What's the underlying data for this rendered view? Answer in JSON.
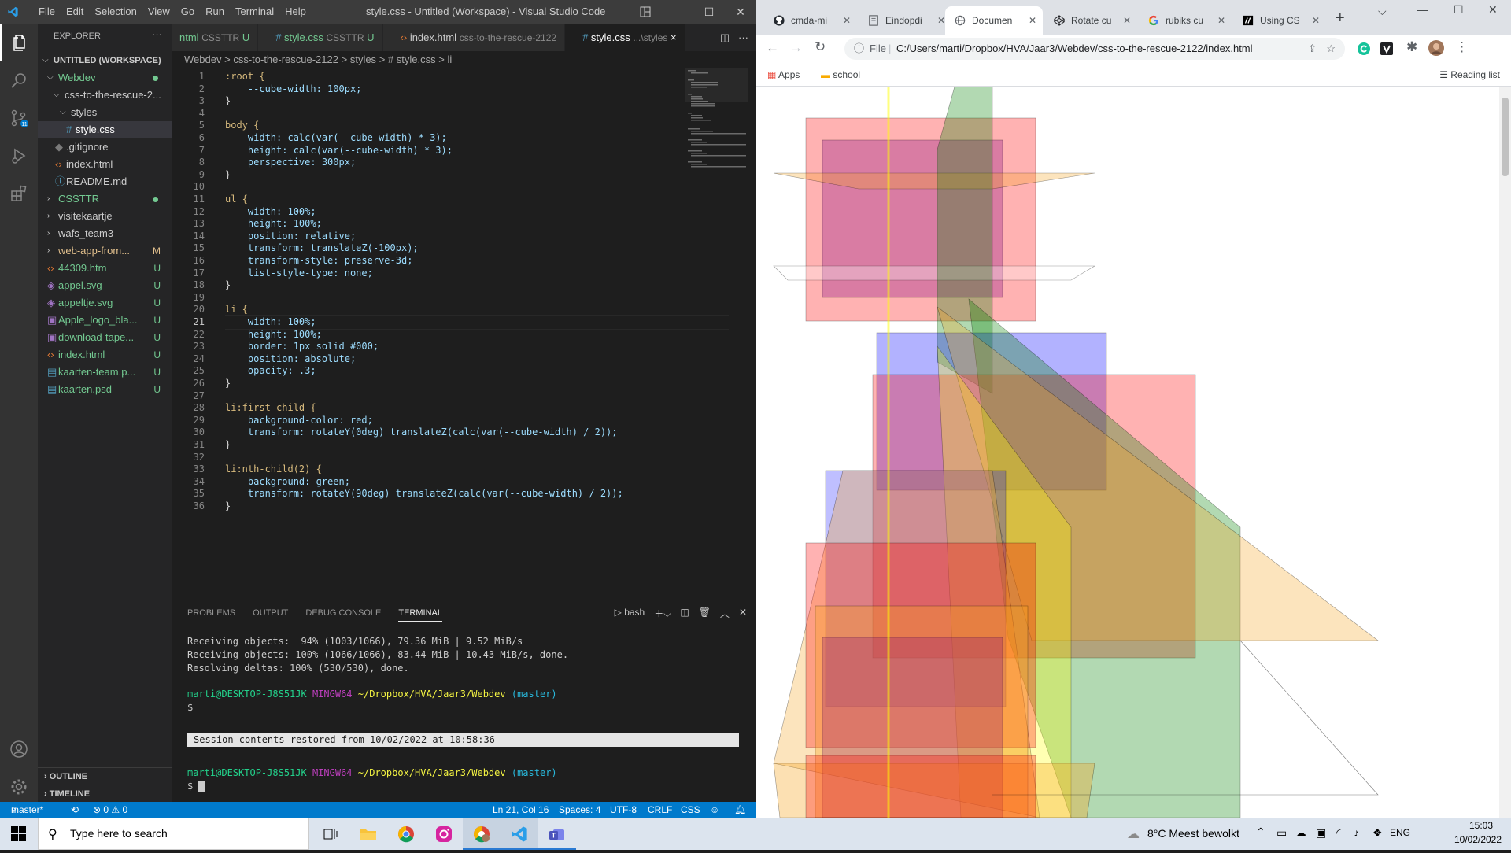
{
  "vscode": {
    "menu": [
      "File",
      "Edit",
      "Selection",
      "View",
      "Go",
      "Run",
      "Terminal",
      "Help"
    ],
    "window_title": "style.css - Untitled (Workspace) - Visual Studio Code",
    "explorer": {
      "header": "EXPLORER",
      "more": "···",
      "workspace": "UNTITLED (WORKSPACE)",
      "items": [
        {
          "label": "Webdev",
          "status": ""
        },
        {
          "label": "css-to-the-rescue-2...",
          "status": ""
        },
        {
          "label": "styles",
          "status": ""
        },
        {
          "label": "style.css",
          "status": ""
        },
        {
          "label": ".gitignore",
          "status": ""
        },
        {
          "label": "index.html",
          "status": ""
        },
        {
          "label": "README.md",
          "status": ""
        },
        {
          "label": "CSSTTR",
          "status": ""
        },
        {
          "label": "visitekaartje",
          "status": ""
        },
        {
          "label": "wafs_team3",
          "status": ""
        },
        {
          "label": "web-app-from...",
          "status": "M"
        },
        {
          "label": "44309.htm",
          "status": "U"
        },
        {
          "label": "appel.svg",
          "status": "U"
        },
        {
          "label": "appeltje.svg",
          "status": "U"
        },
        {
          "label": "Apple_logo_bla...",
          "status": "U"
        },
        {
          "label": "download-tape...",
          "status": "U"
        },
        {
          "label": "index.html",
          "status": "U"
        },
        {
          "label": "kaarten-team.p...",
          "status": "U"
        },
        {
          "label": "kaarten.psd",
          "status": "U"
        }
      ],
      "outline": "OUTLINE",
      "timeline": "TIMELINE"
    },
    "tabs": [
      {
        "name": "ntml",
        "desc": "CSSTTR",
        "badge": "U"
      },
      {
        "name": "style.css",
        "desc": "CSSTTR",
        "badge": "U"
      },
      {
        "name": "index.html",
        "desc": "css-to-the-rescue-2122",
        "badge": ""
      },
      {
        "name": "style.css",
        "desc": "...\\styles",
        "badge": "×"
      }
    ],
    "breadcrumb": [
      "Webdev",
      ">",
      "css-to-the-rescue-2122",
      ">",
      "styles",
      ">",
      "# style.css",
      ">",
      "li"
    ],
    "code": {
      "line_numbers": [
        "1",
        "2",
        "3",
        "4",
        "5",
        "6",
        "7",
        "8",
        "9",
        "10",
        "11",
        "12",
        "13",
        "14",
        "15",
        "16",
        "17",
        "18",
        "19",
        "20",
        "21",
        "22",
        "23",
        "24",
        "25",
        "26",
        "27",
        "28",
        "29",
        "30",
        "31",
        "32",
        "33",
        "34",
        "35",
        "36"
      ],
      "lines": [
        ":root {",
        "    --cube-width: 100px;",
        "}",
        "",
        "body {",
        "    width: calc(var(--cube-width) * 3);",
        "    height: calc(var(--cube-width) * 3);",
        "    perspective: 300px;",
        "}",
        "",
        "ul {",
        "    width: 100%;",
        "    height: 100%;",
        "    position: relative;",
        "    transform: translateZ(-100px);",
        "    transform-style: preserve-3d;",
        "    list-style-type: none;",
        "}",
        "",
        "li {",
        "    width: 100%;",
        "    height: 100%;",
        "    border: 1px solid #000;",
        "    position: absolute;",
        "    opacity: .3;",
        "}",
        "",
        "li:first-child {",
        "    background-color: red;",
        "    transform: rotateY(0deg) translateZ(calc(var(--cube-width) / 2));",
        "}",
        "",
        "li:nth-child(2) {",
        "    background: green;",
        "    transform: rotateY(90deg) translateZ(calc(var(--cube-width) / 2));",
        "}"
      ]
    },
    "panel": {
      "tabs": [
        "PROBLEMS",
        "OUTPUT",
        "DEBUG CONSOLE",
        "TERMINAL"
      ],
      "shell": "bash",
      "terminal_lines": [
        "Receiving objects:  94% (1003/1066), 79.36 MiB | 9.52 MiB/s",
        "Receiving objects: 100% (1066/1066), 83.44 MiB | 10.43 MiB/s, done.",
        "Resolving deltas: 100% (530/530), done."
      ],
      "prompt_user": "marti@DESKTOP-J8S51JK",
      "prompt_env": "MINGW64",
      "prompt_path": "~/Dropbox/HVA/Jaar3/Webdev",
      "prompt_branch": "(master)",
      "dollar": "$",
      "restored": "Session contents restored from 10/02/2022 at 10:58:36"
    },
    "status": {
      "branch": "master*",
      "problems": "⊗ 0 ⚠ 0",
      "position": "Ln 21, Col 16",
      "spaces": "Spaces: 4",
      "encoding": "UTF-8",
      "eol": "CRLF",
      "lang": "CSS"
    }
  },
  "chrome": {
    "tabs": [
      {
        "title": "cmda-mi",
        "active": false
      },
      {
        "title": "Eindopdi",
        "active": false
      },
      {
        "title": "Documen",
        "active": true
      },
      {
        "title": "Rotate cu",
        "active": false
      },
      {
        "title": "rubiks cu",
        "active": false
      },
      {
        "title": "Using CS",
        "active": false
      }
    ],
    "url_prefix": "File",
    "url": "C:/Users/marti/Dropbox/HVA/Jaar3/Webdev/css-to-the-rescue-2122/index.html",
    "bookmarks": {
      "apps": "Apps",
      "school": "school",
      "reading": "Reading list"
    },
    "colors": {
      "red": "#ff0000",
      "green": "#008000",
      "blue": "#0000ff",
      "orange": "#f5a623",
      "yellow": "#ffff00",
      "purple": "#800080"
    }
  },
  "taskbar": {
    "search_placeholder": "Type here to search",
    "weather": "8°C  Meest bewolkt",
    "lang": "ENG",
    "time": "15:03",
    "date": "10/02/2022"
  }
}
